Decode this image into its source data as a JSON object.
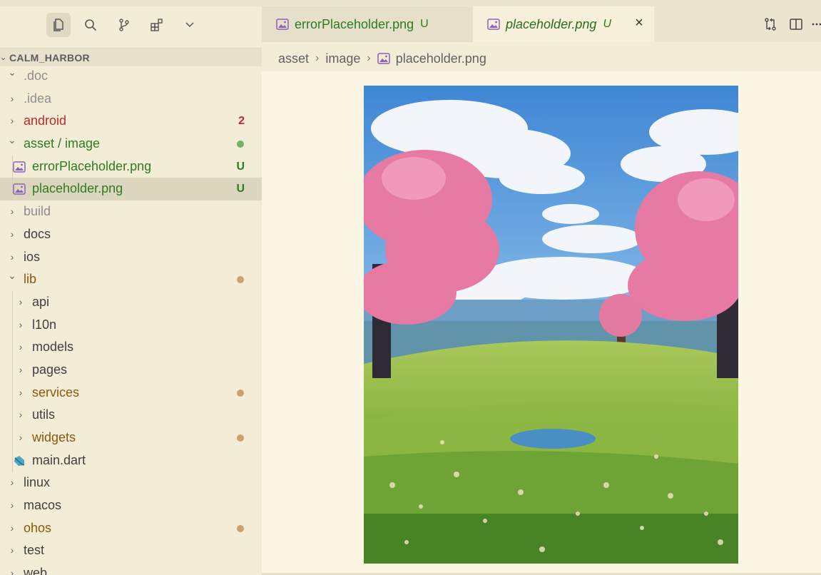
{
  "explorer": {
    "project_title": "CALM_HARBOR",
    "items": [
      {
        "label": ".doc",
        "indent": 0,
        "kind": "folder",
        "expanded": true,
        "color": "dim",
        "status": ""
      },
      {
        "label": ".idea",
        "indent": 0,
        "kind": "folder",
        "expanded": false,
        "color": "dim",
        "status": ""
      },
      {
        "label": "android",
        "indent": 0,
        "kind": "folder",
        "expanded": false,
        "color": "red",
        "status": "2"
      },
      {
        "label": "asset / image",
        "indent": 0,
        "kind": "folder",
        "expanded": true,
        "color": "green",
        "status": "dot-green"
      },
      {
        "label": "errorPlaceholder.png",
        "indent": 1,
        "kind": "image",
        "color": "green",
        "status": "U"
      },
      {
        "label": "placeholder.png",
        "indent": 1,
        "kind": "image",
        "color": "green",
        "status": "U",
        "selected": true
      },
      {
        "label": "build",
        "indent": 0,
        "kind": "folder",
        "expanded": false,
        "color": "dim",
        "status": ""
      },
      {
        "label": "docs",
        "indent": 0,
        "kind": "folder",
        "expanded": false,
        "color": "norm",
        "status": ""
      },
      {
        "label": "ios",
        "indent": 0,
        "kind": "folder",
        "expanded": false,
        "color": "norm",
        "status": ""
      },
      {
        "label": "lib",
        "indent": 0,
        "kind": "folder",
        "expanded": true,
        "color": "gold",
        "status": "dot-gold"
      },
      {
        "label": "api",
        "indent": 1,
        "kind": "folder",
        "expanded": false,
        "color": "norm",
        "status": ""
      },
      {
        "label": "l10n",
        "indent": 1,
        "kind": "folder",
        "expanded": false,
        "color": "norm",
        "status": ""
      },
      {
        "label": "models",
        "indent": 1,
        "kind": "folder",
        "expanded": false,
        "color": "norm",
        "status": ""
      },
      {
        "label": "pages",
        "indent": 1,
        "kind": "folder",
        "expanded": false,
        "color": "norm",
        "status": ""
      },
      {
        "label": "services",
        "indent": 1,
        "kind": "folder",
        "expanded": false,
        "color": "gold",
        "status": "dot-gold"
      },
      {
        "label": "utils",
        "indent": 1,
        "kind": "folder",
        "expanded": false,
        "color": "norm",
        "status": ""
      },
      {
        "label": "widgets",
        "indent": 1,
        "kind": "folder",
        "expanded": false,
        "color": "gold",
        "status": "dot-gold"
      },
      {
        "label": "main.dart",
        "indent": 1,
        "kind": "dart",
        "color": "norm",
        "status": ""
      },
      {
        "label": "linux",
        "indent": 0,
        "kind": "folder",
        "expanded": false,
        "color": "norm",
        "status": ""
      },
      {
        "label": "macos",
        "indent": 0,
        "kind": "folder",
        "expanded": false,
        "color": "norm",
        "status": ""
      },
      {
        "label": "ohos",
        "indent": 0,
        "kind": "folder",
        "expanded": false,
        "color": "gold",
        "status": "dot-gold"
      },
      {
        "label": "test",
        "indent": 0,
        "kind": "folder",
        "expanded": false,
        "color": "norm",
        "status": ""
      },
      {
        "label": "web",
        "indent": 0,
        "kind": "folder",
        "expanded": false,
        "color": "norm",
        "status": ""
      }
    ]
  },
  "activity_bar": [
    {
      "name": "explorer-icon",
      "active": true
    },
    {
      "name": "search-icon",
      "active": false
    },
    {
      "name": "source-control-icon",
      "active": false
    },
    {
      "name": "extensions-icon",
      "active": false
    },
    {
      "name": "chevron-down-icon",
      "active": false
    }
  ],
  "tabs": [
    {
      "label": "errorPlaceholder.png",
      "status": "U",
      "active": false
    },
    {
      "label": "placeholder.png",
      "status": "U",
      "active": true,
      "close": "×"
    }
  ],
  "editor_actions": [
    "open-changes-icon",
    "split-editor-icon",
    "more-actions-icon"
  ],
  "breadcrumb": {
    "parts": [
      "asset",
      "image"
    ],
    "file": "placeholder.png"
  },
  "colors": {
    "git_added": "#2b7d20",
    "git_modified": "#8a5a0c",
    "git_error": "#c0272d",
    "dot_modified": "#c9a36b",
    "dot_added": "#6bb56b",
    "theme_bg": "#f3ecd6"
  }
}
